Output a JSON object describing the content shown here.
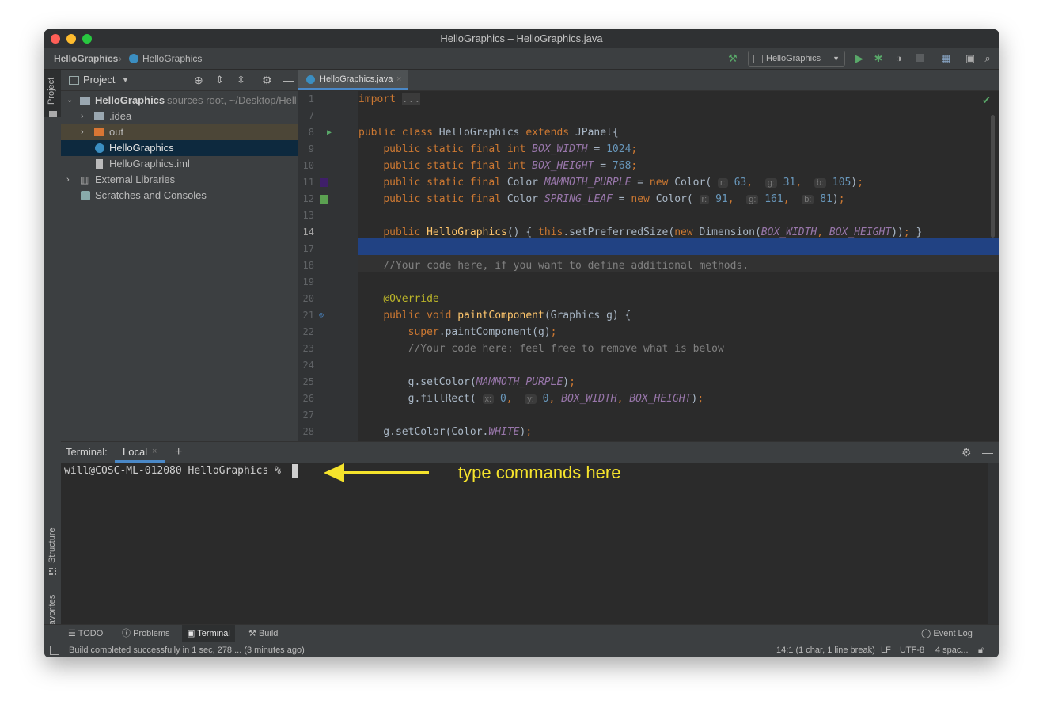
{
  "window": {
    "title": "HelloGraphics – HelloGraphics.java"
  },
  "navbar": {
    "project": "HelloGraphics",
    "file": "HelloGraphics",
    "run_config": "HelloGraphics"
  },
  "sidebar_tabs": {
    "project": "Project",
    "structure": "Structure",
    "favorites": "Favorites"
  },
  "project_panel": {
    "title": "Project",
    "tree": [
      {
        "label": "HelloGraphics",
        "note": "sources root, ~/Desktop/Hell"
      },
      {
        "label": ".idea"
      },
      {
        "label": "out"
      },
      {
        "label": "HelloGraphics"
      },
      {
        "label": "HelloGraphics.iml"
      },
      {
        "label": "External Libraries"
      },
      {
        "label": "Scratches and Consoles"
      }
    ]
  },
  "editor": {
    "tab": "HelloGraphics.java",
    "line_numbers": [
      "1",
      "7",
      "8",
      "9",
      "10",
      "11",
      "12",
      "13",
      "14",
      "17",
      "18",
      "19",
      "20",
      "21",
      "22",
      "23",
      "24",
      "25",
      "26",
      "27",
      "28"
    ]
  },
  "terminal": {
    "label": "Terminal:",
    "tab": "Local",
    "prompt": "will@COSC-ML-012080 HelloGraphics %",
    "annotation": "type commands here"
  },
  "bottom_tabs": [
    "TODO",
    "Problems",
    "Terminal",
    "Build"
  ],
  "event_log": "Event Log",
  "status": {
    "message": "Build completed successfully in 1 sec, 278 ... (3 minutes ago)",
    "position": "14:1 (1 char, 1 line break)",
    "line_sep": "LF",
    "encoding": "UTF-8",
    "indent": "4 spac..."
  },
  "colors": {
    "accent": "#2f65ca",
    "mammoth_purple": "#3f1f69",
    "spring_leaf": "#5ba151",
    "arrow": "#f5e32c"
  }
}
